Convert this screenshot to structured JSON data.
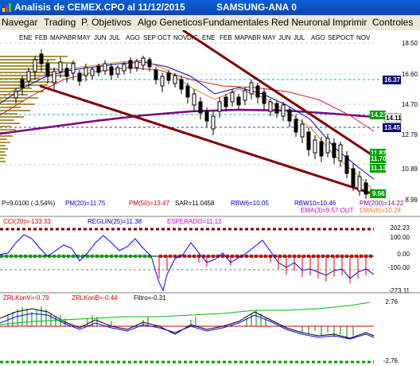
{
  "window": {
    "title": "Analisis de CEMEX.CPO al 11/12/2015",
    "device": "SAMSUNG-ANA 0"
  },
  "menu": [
    "Navegar",
    "Trading",
    "P. Objetivos",
    "Algo Geneticos",
    "Fundamentales",
    "Red Neuronal",
    "Imprimir",
    "Controles"
  ],
  "price_panel": {
    "months": [
      "ENE",
      "FEB",
      "MAPA",
      "BR",
      "MAY",
      "JUN",
      "JUL",
      "AGO",
      "SEP",
      "OCT",
      "NOV",
      "DIC",
      "ENE",
      "FEB",
      "MAPA",
      "BR",
      "MAY",
      "JUN",
      "JUL",
      "AGO",
      "SEP",
      "OCT",
      "NOV"
    ],
    "axis_ticks": [
      "18.50",
      "16.60",
      "14.70",
      "12.79",
      "10.89",
      "8.99"
    ],
    "tags": [
      {
        "text": "16.37",
        "bg": "#00007f",
        "fg": "#ffffff"
      },
      {
        "text": "14.21",
        "bg": "#00a000",
        "fg": "#ffffff"
      },
      {
        "text": "14.11",
        "bg": "#ffffff",
        "fg": "#000000"
      },
      {
        "text": "13.45",
        "bg": "#00007f",
        "fg": "#ffffff"
      },
      {
        "text": "11.82",
        "bg": "#00a000",
        "fg": "#ffffff"
      },
      {
        "text": "11.70",
        "bg": "#00a000",
        "fg": "#ffffff"
      },
      {
        "text": "11.13",
        "bg": "#00a000",
        "fg": "#ffffff"
      },
      {
        "text": "9.56",
        "bg": "#00a000",
        "fg": "#ffffff"
      }
    ],
    "stats_row1": {
      "price": "P=9.0100 (-3.54%)",
      "pm20": "PM(20)=11.75",
      "pm50": "PM(50)=13.47",
      "sar": "SAR=11.0458",
      "rbw6": "RBW6=10.05",
      "rbw10": "RBW10=10.46",
      "pm200": "PM(200)=14.22"
    },
    "stats_row2": {
      "ema3": "EMA(3)=9.57 OUT",
      "ema8": "EMA(8)=10.28"
    }
  },
  "cci_panel": {
    "cci": "CCI(20)=-133.33",
    "reglin": "REGLIN(25)=11.38",
    "esperado": "ESPERADO=11.12",
    "axis_ticks": [
      "202.23",
      "100.00",
      "0.00",
      "-100.00",
      "-273.11"
    ]
  },
  "zrl_panel": {
    "zrlkonv": "ZRLKonV=-0.79",
    "zrlkonb": "ZRLKonB=-0.44",
    "filtro": "Filtro=-0.31",
    "axis_ticks": [
      "2.76",
      "-2.76"
    ]
  },
  "colors": {
    "title_bar": "#0b4fc9",
    "menu_bg": "#ece9d8",
    "pm200": "#7f007f",
    "pm50": "#cc0000",
    "pm20": "#0000cc",
    "trendline": "#7f0000",
    "volume_profile": "#8b7b00",
    "cci_line": "#0000ff",
    "zrl_green": "#008000"
  }
}
